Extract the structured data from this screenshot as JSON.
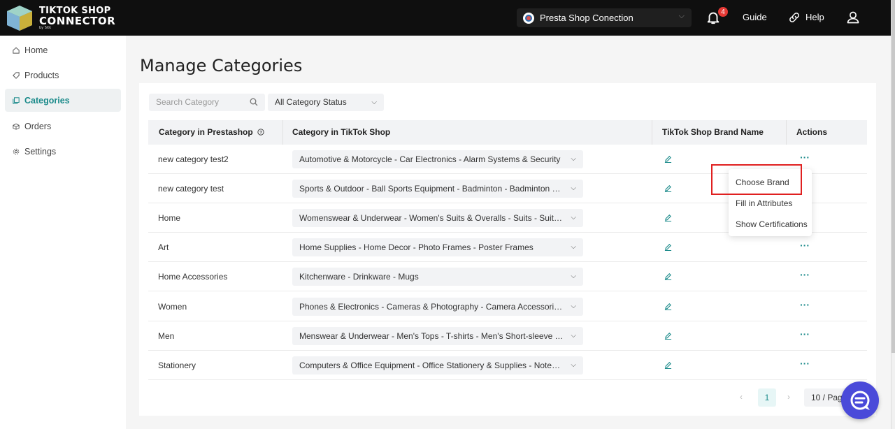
{
  "header": {
    "logo": {
      "line1": "TIKTOK SHOP",
      "line2": "CONNECTOR",
      "line3": "by Sitk"
    },
    "shop_selector": {
      "value": "Presta Shop Conection",
      "icon": "shop-logo-icon"
    },
    "notifications": {
      "count": "4",
      "icon": "bell-icon"
    },
    "guide_label": "Guide",
    "help_label": "Help",
    "user_icon": "user-icon"
  },
  "sidebar": {
    "items": [
      {
        "label": "Home",
        "icon": "home-icon",
        "active": false
      },
      {
        "label": "Products",
        "icon": "tag-icon",
        "active": false
      },
      {
        "label": "Categories",
        "icon": "copy-icon",
        "active": true
      },
      {
        "label": "Orders",
        "icon": "box-icon",
        "active": false
      },
      {
        "label": "Settings",
        "icon": "gear-icon",
        "active": false
      }
    ]
  },
  "main": {
    "title": "Manage Categories",
    "search": {
      "placeholder": "Search Category"
    },
    "status_filter": {
      "value": "All Category Status"
    },
    "table": {
      "columns": [
        "Category in Prestashop",
        "Category in TikTok Shop",
        "TikTok Shop Brand Name",
        "Actions"
      ],
      "rows": [
        {
          "name": "new category test2",
          "tiktok_category": "Automotive & Motorcycle - Car Electronics - Alarm Systems & Security",
          "actions": "···"
        },
        {
          "name": "new category test",
          "tiktok_category": "Sports & Outdoor - Ball Sports Equipment - Badminton - Badminton Co...",
          "actions": "···"
        },
        {
          "name": "Home",
          "tiktok_category": "Womenswear & Underwear - Women's Suits & Overalls - Suits - Suit Sep...",
          "actions": "···"
        },
        {
          "name": "Art",
          "tiktok_category": "Home Supplies - Home Decor - Photo Frames - Poster Frames",
          "actions": "···"
        },
        {
          "name": "Home Accessories",
          "tiktok_category": "Kitchenware - Drinkware - Mugs",
          "actions": "···"
        },
        {
          "name": "Women",
          "tiktok_category": "Phones & Electronics - Cameras & Photography - Camera Accessories - ...",
          "actions": "···"
        },
        {
          "name": "Men",
          "tiktok_category": "Menswear & Underwear - Men's Tops - T-shirts - Men's Short-sleeve T-s...",
          "actions": "···"
        },
        {
          "name": "Stationery",
          "tiktok_category": "Computers & Office Equipment - Office Stationery & Supplies - Noteboo...",
          "actions": "···"
        }
      ]
    },
    "actions_menu": {
      "items": [
        "Choose Brand",
        "Fill in Attributes",
        "Show Certifications"
      ]
    },
    "pagination": {
      "prev": "‹",
      "current_page": "1",
      "next": "›",
      "page_size": "10  / Pag"
    }
  },
  "colors": {
    "accent": "#1a8a8a",
    "header_bg": "#0f0f0f",
    "highlight": "#e02020",
    "chat": "#4a4ad9"
  }
}
